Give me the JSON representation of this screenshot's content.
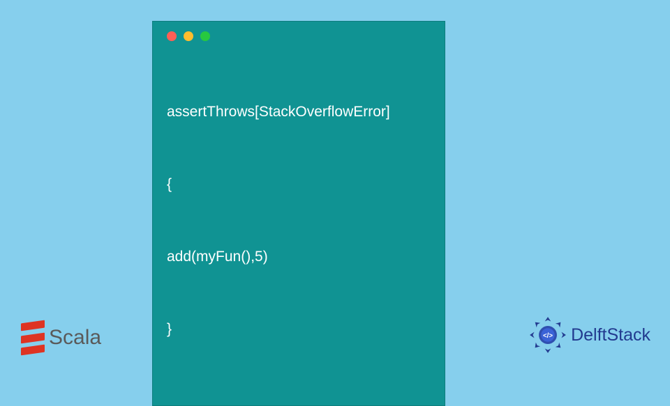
{
  "code": {
    "lines": [
      "assertThrows[StackOverflowError]",
      "{",
      "add(myFun(),5)",
      "}"
    ]
  },
  "scala": {
    "label": "Scala"
  },
  "delft": {
    "label": "DelftStack"
  },
  "colors": {
    "bg": "#86cfed",
    "window": "#109393",
    "scala_red": "#de3423",
    "delft_blue": "#223a8f"
  }
}
